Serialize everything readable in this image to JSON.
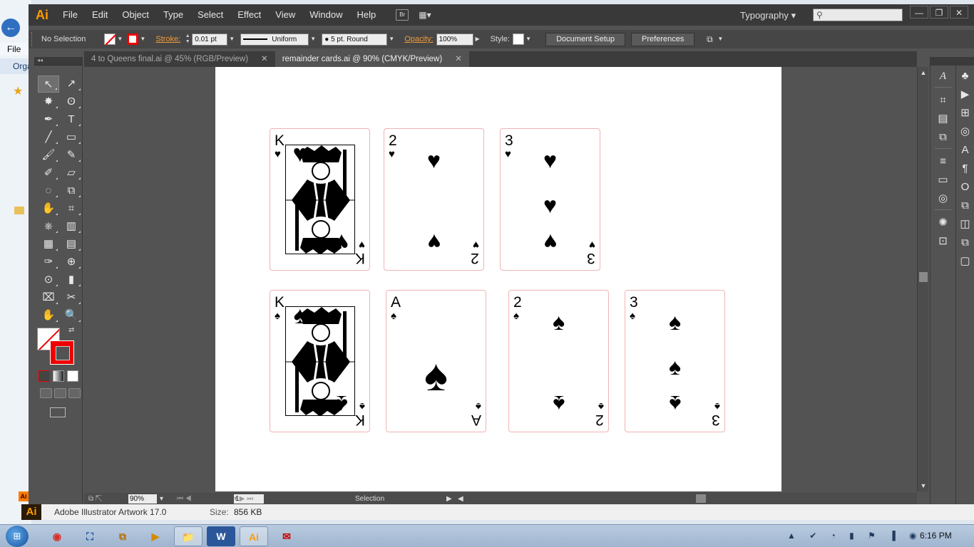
{
  "app": {
    "logo": "Ai",
    "menus": [
      "File",
      "Edit",
      "Object",
      "Type",
      "Select",
      "Effect",
      "View",
      "Window",
      "Help"
    ],
    "bridge_button": "Br",
    "workspace": "Typography",
    "workspace_arrow": "▾",
    "search_placeholder": "",
    "window_controls": {
      "minimize": "—",
      "restore": "❐",
      "close": "✕"
    }
  },
  "controlbar": {
    "selection": "No Selection",
    "stroke_label": "Stroke:",
    "stroke_weight": "0.01 pt",
    "profile": "Uniform",
    "brush": "5 pt. Round",
    "brush_dot": "●",
    "opacity_label": "Opacity:",
    "opacity": "100%",
    "style_label": "Style:",
    "document_setup": "Document Setup",
    "preferences": "Preferences"
  },
  "tabs": [
    {
      "label": "4 to Queens final.ai @ 45% (RGB/Preview)",
      "close": "✕"
    },
    {
      "label": "remainder cards.ai @ 90% (CMYK/Preview)",
      "close": "✕"
    }
  ],
  "explorer": {
    "file_menu": "File",
    "organize": "Orga"
  },
  "tools": {
    "header": "◂◂",
    "items": [
      "↖",
      "↗",
      "✸",
      "ʘ",
      "✒",
      "T",
      "╱",
      "▭",
      "🖌",
      "✎",
      "✐",
      "▱",
      "◌",
      "⧉",
      "✋",
      "⌗",
      "⎈",
      "▥",
      "▦",
      "▤",
      "✑",
      "⊕",
      "⊙",
      "▮",
      "⌧",
      "✂",
      "✋",
      "🔍"
    ]
  },
  "cards": [
    {
      "rank": "K",
      "suit": "♥",
      "face": true
    },
    {
      "rank": "2",
      "suit": "♥",
      "face": false
    },
    {
      "rank": "3",
      "suit": "♥",
      "face": false
    },
    {
      "rank": "K",
      "suit": "♠",
      "face": true
    },
    {
      "rank": "A",
      "suit": "♠",
      "face": false
    },
    {
      "rank": "2",
      "suit": "♠",
      "face": false
    },
    {
      "rank": "3",
      "suit": "♠",
      "face": false
    }
  ],
  "statusbar": {
    "zoom": "90%",
    "page": "1",
    "mode": "Selection"
  },
  "infostrip": {
    "filetype": "Adobe Illustrator Artwork 17.0",
    "size_label": "Size:",
    "size_value": "856 KB"
  },
  "taskbar": {
    "start": "⊞",
    "apps": [
      "◉",
      "⛶",
      "⧉",
      "▶",
      "📁",
      "W",
      "Ai",
      "✉"
    ],
    "tray": "▲ ✔ ◔ ▮ ⚑ ▐ ◉",
    "clock": "6:16 PM"
  }
}
